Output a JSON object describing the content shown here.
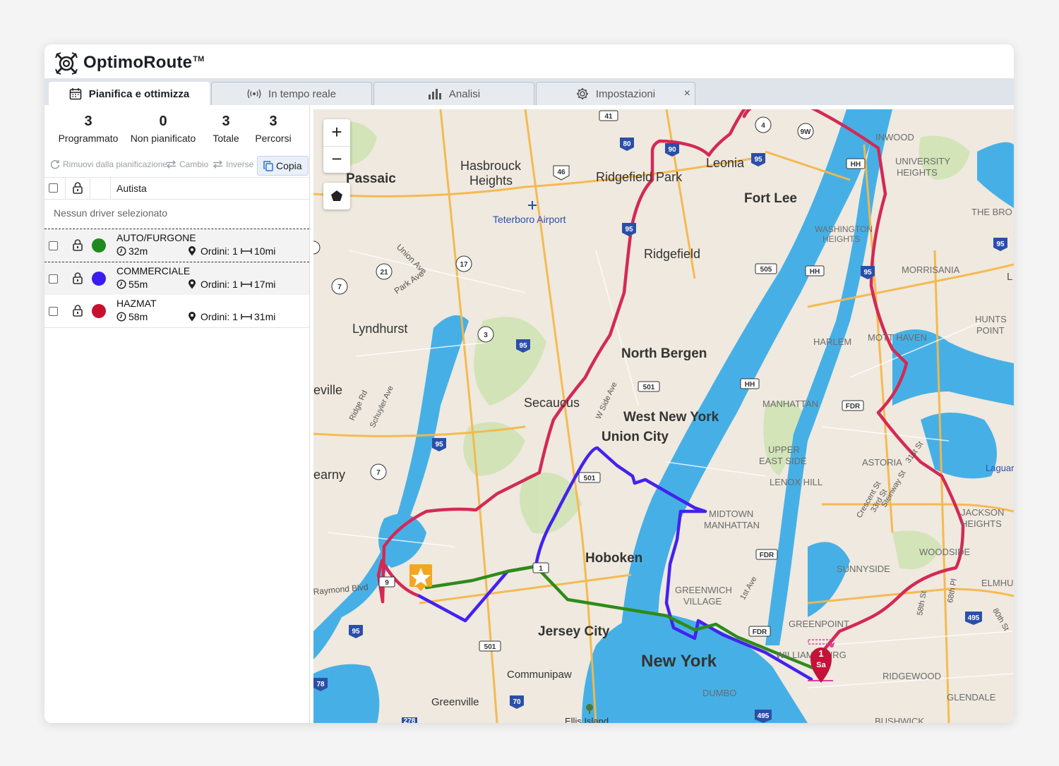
{
  "app": {
    "name": "OptimoRoute",
    "tm": "TM"
  },
  "tabs": [
    {
      "label": "Pianifica e ottimizza",
      "icon": "calendar-icon",
      "active": true
    },
    {
      "label": "In tempo reale",
      "icon": "broadcast-icon",
      "active": false
    },
    {
      "label": "Analisi",
      "icon": "bar-chart-icon",
      "active": false
    },
    {
      "label": "Impostazioni",
      "icon": "gear-icon",
      "active": false
    }
  ],
  "tab_close": "×",
  "stats": [
    {
      "value": "3",
      "label": "Programmato"
    },
    {
      "value": "0",
      "label": "Non pianificato"
    },
    {
      "value": "3",
      "label": "Totale"
    },
    {
      "value": "3",
      "label": "Percorsi"
    }
  ],
  "actions": {
    "remove": "Rimuovi dalla pianificazione",
    "swap": "Cambio",
    "reverse": "Inverse",
    "copy": "Copia"
  },
  "table": {
    "header": "Autista",
    "empty": "Nessun driver selezionato"
  },
  "drivers": [
    {
      "name": "AUTO/FURGONE",
      "color": "#1e8a1e",
      "time": "32m",
      "orders": "Ordini: 1",
      "distance": "10mi"
    },
    {
      "name": "COMMERCIALE",
      "color": "#3b1cf0",
      "time": "55m",
      "orders": "Ordini: 1",
      "distance": "17mi"
    },
    {
      "name": "HAZMAT",
      "color": "#c8102e",
      "time": "58m",
      "orders": "Ordini: 1",
      "distance": "31mi"
    }
  ],
  "map": {
    "zoom_in": "+",
    "zoom_out": "−",
    "marker_number": "1",
    "marker_label": "Sa",
    "route_colors": {
      "green": "#2e8b1a",
      "blue": "#4422ee",
      "red": "#d32a55"
    },
    "labels": {
      "passaic": "Passaic",
      "hasbrouck": "Hasbrouck",
      "heights": "Heights",
      "ridgefield_park": "Ridgefield Park",
      "leonia": "Leonia",
      "fort_lee": "Fort Lee",
      "inwood": "INWOOD",
      "university_heights_1": "UNIVERSITY",
      "university_heights_2": "HEIGHTS",
      "the_bronx": "THE BRO",
      "teterboro": "Teterboro Airport",
      "washington_heights_1": "WASHINGTON",
      "washington_heights_2": "HEIGHTS",
      "ridgefield": "Ridgefield",
      "morrisania": "MORRISANIA",
      "union_ave": "Union Ave",
      "park_ave": "Park Ave",
      "hunts_point_1": "HUNTS",
      "hunts_point_2": "POINT",
      "lyndhurst": "Lyndhurst",
      "harlem": "HARLEM",
      "mott_haven": "MOTT HAVEN",
      "north_bergen": "North Bergen",
      "eville": "eville",
      "ridge_rd": "Ridge Rd",
      "schuyler_ave": "Schuyler Ave",
      "w_side_ave": "W Side Ave",
      "secaucus": "Secaucus",
      "west_new_york": "West New York",
      "manhattan": "MANHATTAN",
      "union_city": "Union City",
      "upper_east_side_1": "UPPER",
      "upper_east_side_2": "EAST SIDE",
      "astoria": "ASTORIA",
      "first_st": "31st St",
      "laguardia": "Laguard",
      "kearny": "earny",
      "lenox_hill": "LENOX HILL",
      "crescent_st": "Crescent St",
      "steinway_st": "Steinway St",
      "third_st": "33rd St",
      "midtown_1": "MIDTOWN",
      "midtown_2": "MANHATTAN",
      "jackson_heights_1": "JACKSON",
      "jackson_heights_2": "HEIGHTS",
      "hoboken": "Hoboken",
      "woodside": "WOODSIDE",
      "sunnyside": "SUNNYSIDE",
      "raymond_blvd": "Raymond Blvd",
      "greenwich_village_1": "GREENWICH",
      "greenwich_village_2": "VILLAGE",
      "first_ave": "1st Ave",
      "elmhurst": "ELMHU",
      "jersey_city": "Jersey City",
      "greenpoint": "GREENPOINT",
      "fifty_eighth": "58th St",
      "sixty_eighth": "68th Pl",
      "eightieth": "80th St",
      "williamsburg": "WILLIAMSBURG",
      "new_york": "New York",
      "communipaw": "Communipaw",
      "ridgewood": "RIDGEWOOD",
      "dumbo": "DUMBO",
      "glendale": "GLENDALE",
      "greenville": "Greenville",
      "ellis_island": "Ellis Island",
      "bushwick": "BUSHWICK",
      "l_edge": "L"
    },
    "shields": [
      "41",
      "80",
      "90",
      "4",
      "9W",
      "95",
      "46",
      "HH",
      "505",
      "HH",
      "95",
      "95",
      "21",
      "17",
      "7",
      "3",
      "95",
      "501",
      "HH",
      "FDR",
      "95",
      "7",
      "501",
      "1",
      "9",
      "FDR",
      "FDR",
      "495",
      "95",
      "501",
      "78",
      "70",
      "495",
      "278",
      "95"
    ]
  }
}
